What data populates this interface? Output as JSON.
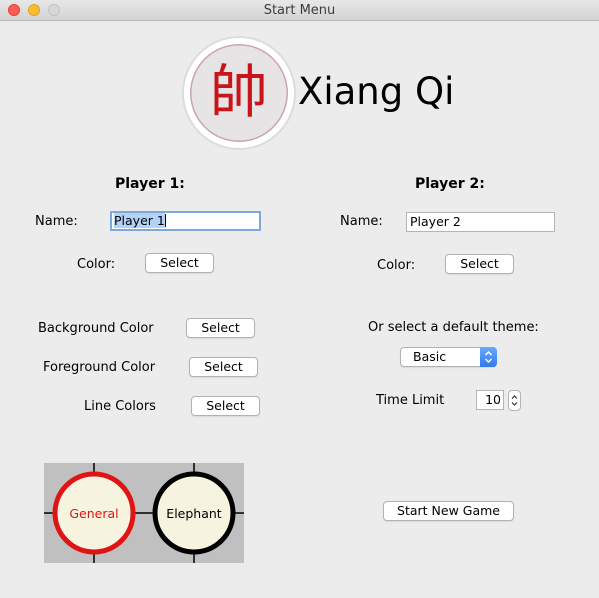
{
  "window": {
    "title": "Start Menu",
    "lights": [
      "#fd5b54",
      "#fdbb2e",
      "#d6d6d6"
    ]
  },
  "logo": {
    "glyph": "帥",
    "glyph_color": "#c8141b",
    "app_name": "Xiang Qi"
  },
  "player1": {
    "heading": "Player 1:",
    "name_label": "Name:",
    "name_value": "Player 1",
    "color_label": "Color:",
    "color_button": "Select"
  },
  "player2": {
    "heading": "Player 2:",
    "name_label": "Name:",
    "name_value": "Player 2",
    "color_label": "Color:",
    "color_button": "Select"
  },
  "board_colors": {
    "background_label": "Background Color",
    "background_button": "Select",
    "foreground_label": "Foreground Color",
    "foreground_button": "Select",
    "line_label": "Line Colors",
    "line_button": "Select"
  },
  "theme": {
    "prompt": "Or select a default theme:",
    "selected": "Basic"
  },
  "time_limit": {
    "label": "Time Limit",
    "value": "10"
  },
  "preview": {
    "bg_color": "#c0c0c0",
    "piece_fill": "#f6f3de",
    "general": {
      "label": "General",
      "color": "#e01414"
    },
    "elephant": {
      "label": "Elephant",
      "color": "#000000"
    }
  },
  "start_button": "Start New Game"
}
